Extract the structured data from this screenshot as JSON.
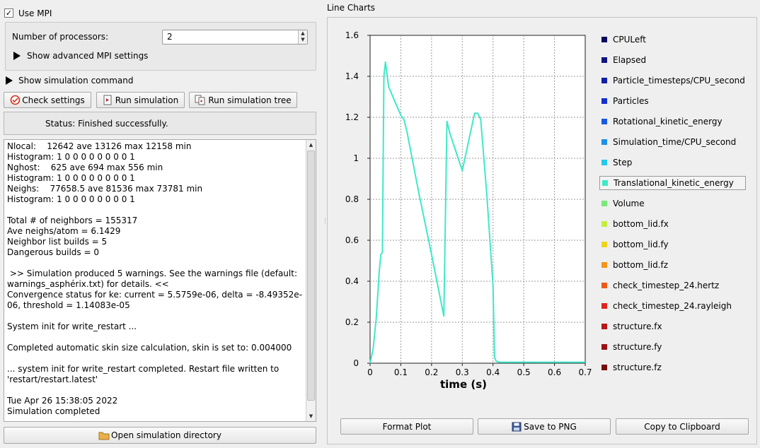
{
  "mpi": {
    "use_label": "Use MPI",
    "checked_glyph": "✓",
    "processors_label": "Number of processors:",
    "processors_value": "2",
    "advanced_label": "Show advanced MPI settings"
  },
  "simulation": {
    "show_command_label": "Show simulation command",
    "check_label": "Check settings",
    "run_label": "Run simulation",
    "run_tree_label": "Run simulation tree",
    "status_text": "Status: Finished successfully.",
    "open_dir_label": "Open simulation directory"
  },
  "log": {
    "text": "Nlocal:    12642 ave 13126 max 12158 min\nHistogram: 1 0 0 0 0 0 0 0 0 1\nNghost:    625 ave 694 max 556 min\nHistogram: 1 0 0 0 0 0 0 0 0 1\nNeighs:    77658.5 ave 81536 max 73781 min\nHistogram: 1 0 0 0 0 0 0 0 0 1\n\nTotal # of neighbors = 155317\nAve neighs/atom = 6.1429\nNeighbor list builds = 5\nDangerous builds = 0\n\n >> Simulation produced 5 warnings. See the warnings file (default: warnings_asphérix.txt) for details. <<\nConvergence status for ke: current = 5.5759e-06, delta = -8.49352e-06, threshold = 1.14083e-05\n\nSystem init for write_restart ...\n\nCompleted automatic skin size calculation, skin is set to: 0.004000\n\n... system init for write_restart completed. Restart file written to 'restart/restart.latest'\n\nTue Apr 26 15:38:05 2022\nSimulation completed"
  },
  "charts": {
    "group_title": "Line Charts",
    "format_label": "Format Plot",
    "save_label": "Save to PNG",
    "copy_label": "Copy to Clipboard"
  },
  "legend": [
    {
      "label": "CPULeft",
      "color": "#0a0a5e"
    },
    {
      "label": "Elapsed",
      "color": "#0d1680"
    },
    {
      "label": "Particle_timesteps/CPU_second",
      "color": "#1020a6"
    },
    {
      "label": "Particles",
      "color": "#1430cc"
    },
    {
      "label": "Rotational_kinetic_energy",
      "color": "#1a5ae0"
    },
    {
      "label": "Simulation_time/CPU_second",
      "color": "#1e90e8"
    },
    {
      "label": "Step",
      "color": "#24c8ec"
    },
    {
      "label": "Translational_kinetic_energy",
      "color": "#40e8c8",
      "selected": true
    },
    {
      "label": "Volume",
      "color": "#7ae87a"
    },
    {
      "label": "bottom_lid.fx",
      "color": "#c8ec3a"
    },
    {
      "label": "bottom_lid.fy",
      "color": "#f0d41a"
    },
    {
      "label": "bottom_lid.fz",
      "color": "#f49418"
    },
    {
      "label": "check_timestep_24.hertz",
      "color": "#ec5a18"
    },
    {
      "label": "check_timestep_24.rayleigh",
      "color": "#e0241a"
    },
    {
      "label": "structure.fx",
      "color": "#b81818"
    },
    {
      "label": "structure.fy",
      "color": "#981212"
    },
    {
      "label": "structure.fz",
      "color": "#780c0c"
    }
  ],
  "chart_data": {
    "type": "line",
    "title": "",
    "xlabel": "time (s)",
    "ylabel": "",
    "xlim": [
      0,
      0.7
    ],
    "ylim": [
      0,
      1.6
    ],
    "x_ticks": [
      "0",
      "0.1",
      "0.2",
      "0.3",
      "0.4",
      "0.5",
      "0.6",
      "0.7"
    ],
    "y_ticks": [
      "0",
      "0.2",
      "0.4",
      "0.6",
      "0.8",
      "1",
      "1.2",
      "1.4",
      "1.6"
    ],
    "grid": true,
    "legend_position": "right",
    "series": [
      {
        "name": "Translational_kinetic_energy",
        "color": "#40e8c8",
        "x": [
          0,
          0.01,
          0.02,
          0.03,
          0.035,
          0.04,
          0.045,
          0.05,
          0.06,
          0.08,
          0.1,
          0.11,
          0.12,
          0.16,
          0.2,
          0.24,
          0.25,
          0.26,
          0.3,
          0.32,
          0.34,
          0.35,
          0.36,
          0.38,
          0.4,
          0.405,
          0.41,
          0.42,
          0.7
        ],
        "y": [
          0,
          0.07,
          0.22,
          0.45,
          0.53,
          0.54,
          1.4,
          1.47,
          1.35,
          1.28,
          1.21,
          1.19,
          1.13,
          0.82,
          0.53,
          0.23,
          1.18,
          1.12,
          0.94,
          1.08,
          1.22,
          1.22,
          1.19,
          0.82,
          0.38,
          0.03,
          0.01,
          0.005,
          0.005
        ]
      }
    ]
  }
}
